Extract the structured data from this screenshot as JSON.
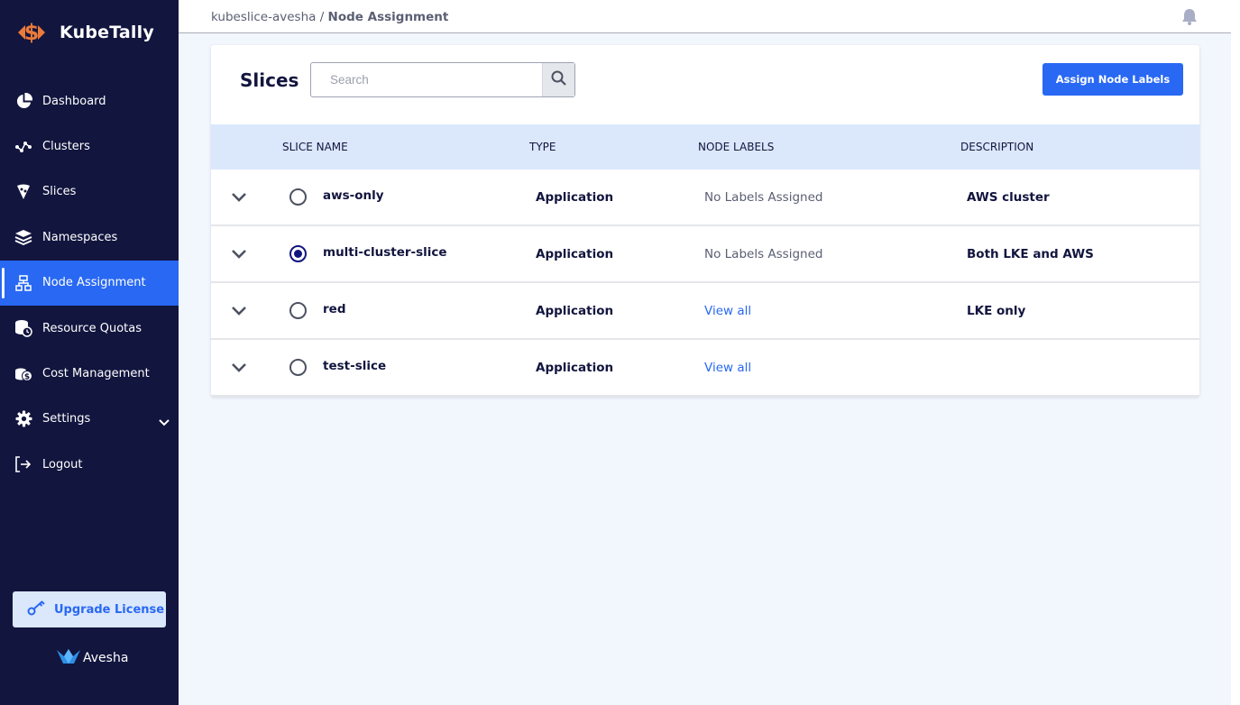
{
  "app": {
    "name": "KubeTally"
  },
  "sidebar": {
    "items": [
      {
        "label": "Dashboard"
      },
      {
        "label": "Clusters"
      },
      {
        "label": "Slices"
      },
      {
        "label": "Namespaces"
      },
      {
        "label": "Node Assignment",
        "active": true
      },
      {
        "label": "Resource Quotas"
      },
      {
        "label": "Cost Management"
      },
      {
        "label": "Settings"
      },
      {
        "label": "Logout"
      }
    ],
    "upgrade_label": "Upgrade License",
    "footer_brand": "Avesha"
  },
  "header": {
    "breadcrumb_root": "kubeslice-avesha",
    "breadcrumb_sep": " / ",
    "breadcrumb_current": "Node Assignment"
  },
  "card": {
    "title": "Slices",
    "search_placeholder": "Search",
    "assign_button": "Assign Node Labels",
    "columns": [
      "SLICE NAME",
      "TYPE",
      "NODE LABELS",
      "DESCRIPTION"
    ],
    "rows": [
      {
        "name": "aws-only",
        "type": "Application",
        "labels": "No Labels Assigned",
        "labels_link": false,
        "desc": "AWS cluster",
        "selected": false
      },
      {
        "name": "multi-cluster-slice",
        "type": "Application",
        "labels": "No Labels Assigned",
        "labels_link": false,
        "desc": "Both LKE and AWS",
        "selected": true
      },
      {
        "name": "red",
        "type": "Application",
        "labels": "View all",
        "labels_link": true,
        "desc": "LKE only",
        "selected": false
      },
      {
        "name": "test-slice",
        "type": "Application",
        "labels": "View all",
        "labels_link": true,
        "desc": "",
        "selected": false
      }
    ]
  },
  "colors": {
    "sidebar_bg": "#12153e",
    "accent": "#2868f3",
    "table_header_bg": "#dbe7fb",
    "logo_orange": "#e97a3a"
  }
}
